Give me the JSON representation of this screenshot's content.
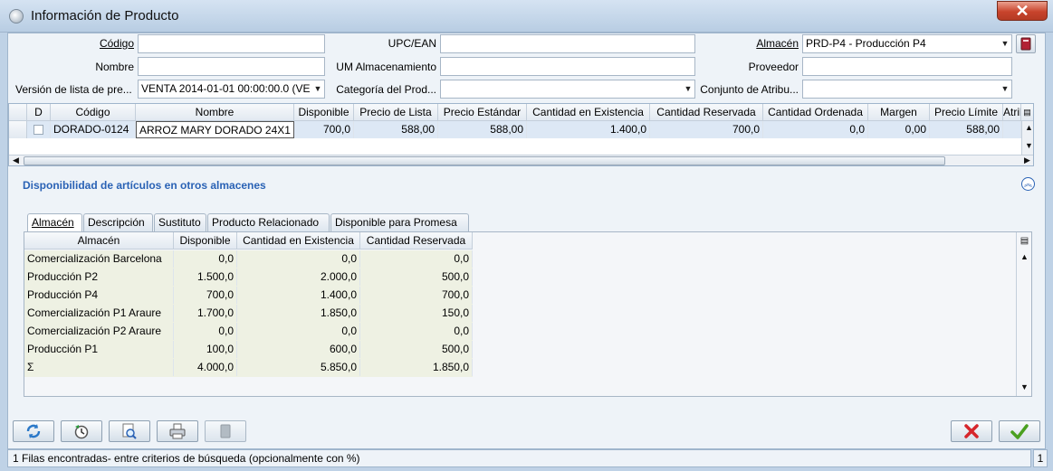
{
  "window": {
    "title": "Información de Producto",
    "close_label": "✕"
  },
  "search": {
    "codigo_label": "Código",
    "codigo_value": "",
    "upc_label": "UPC/EAN",
    "upc_value": "",
    "almacen_label": "Almacén",
    "almacen_value": "PRD-P4 - Producción P4",
    "nombre_label": "Nombre",
    "nombre_value": "",
    "um_label": "UM Almacenamiento",
    "um_value": "",
    "proveedor_label": "Proveedor",
    "proveedor_value": "",
    "version_label": "Versión de lista de pre...",
    "version_value": "VENTA 2014-01-01 00:00:00.0 (VE",
    "categoria_label": "Categoría del Prod...",
    "categoria_value": "",
    "conjunto_label": "Conjunto de Atribu...",
    "conjunto_value": ""
  },
  "product_table": {
    "headers": [
      "D",
      "Código",
      "Nombre",
      "Disponible",
      "Precio de Lista",
      "Precio Estándar",
      "Cantidad en Existencia",
      "Cantidad Reservada",
      "Cantidad Ordenada",
      "Margen",
      "Precio Límite",
      "Atribu"
    ],
    "rows": [
      [
        "",
        "DORADO-0124",
        "ARROZ MARY DORADO 24X1",
        "700,0",
        "588,00",
        "588,00",
        "1.400,0",
        "700,0",
        "0,0",
        "0,00",
        "588,00",
        ""
      ]
    ]
  },
  "availability": {
    "section_title": "Disponibilidad de artículos en otros almacenes",
    "tabs": [
      "Almacén",
      "Descripción",
      "Sustituto",
      "Producto Relacionado",
      "Disponible para Promesa"
    ],
    "headers": [
      "Almacén",
      "Disponible",
      "Cantidad en Existencia",
      "Cantidad Reservada"
    ],
    "rows": [
      [
        "Comercialización Barcelona",
        "0,0",
        "0,0",
        "0,0"
      ],
      [
        "Producción P2",
        "1.500,0",
        "2.000,0",
        "500,0"
      ],
      [
        "Producción P4",
        "700,0",
        "1.400,0",
        "700,0"
      ],
      [
        "Comercialización P1 Araure",
        "1.700,0",
        "1.850,0",
        "150,0"
      ],
      [
        "Comercialización P2 Araure",
        "0,0",
        "0,0",
        "0,0"
      ],
      [
        "Producción P1",
        "100,0",
        "600,0",
        "500,0"
      ],
      [
        "Σ",
        "4.000,0",
        "5.850,0",
        "1.850,0"
      ]
    ]
  },
  "status": {
    "message": "1 Filas encontradas- entre criterios de búsqueda (opcionalmente con %)",
    "count": "1"
  },
  "colors": {
    "accent": "#2a62b5",
    "cancel": "#d6262b",
    "ok": "#4aa020"
  }
}
